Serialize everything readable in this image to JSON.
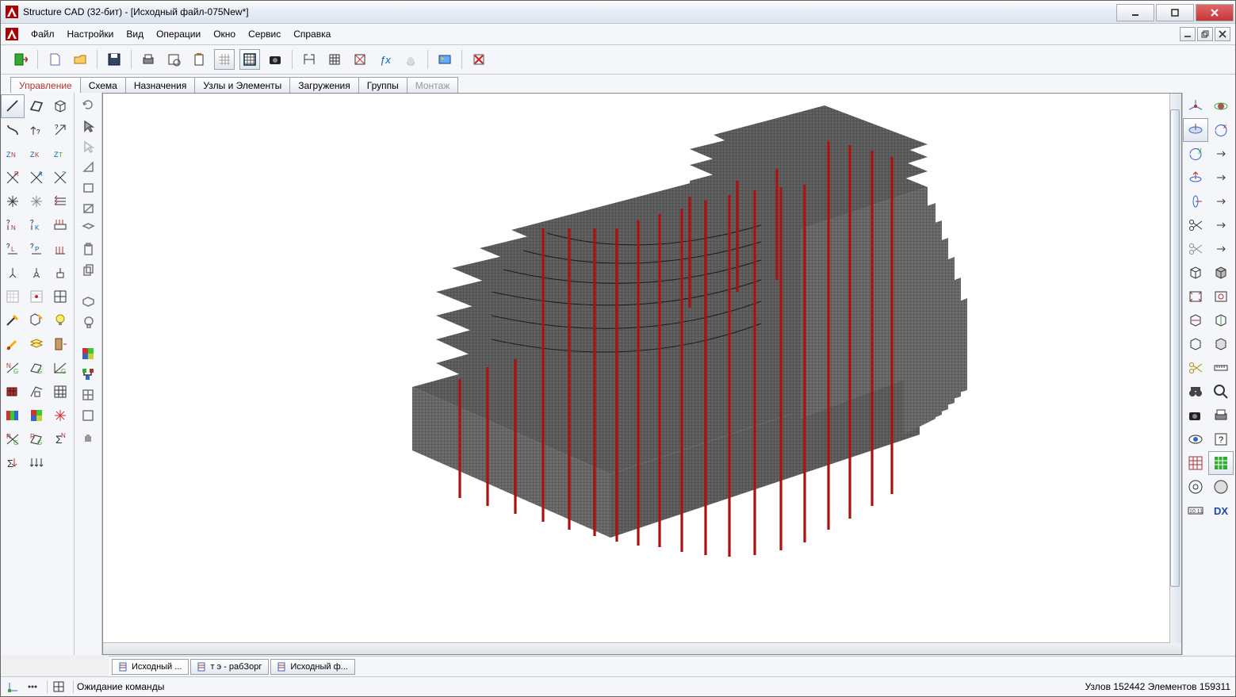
{
  "window": {
    "title": "Structure CAD (32-бит) - [Исходный файл-075New*]"
  },
  "menu": {
    "file": "Файл",
    "settings": "Настройки",
    "view": "Вид",
    "ops": "Операции",
    "window": "Окно",
    "service": "Сервис",
    "help": "Справка"
  },
  "tabs": {
    "t0": "Управление",
    "t1": "Схема",
    "t2": "Назначения",
    "t3": "Узлы и Элементы",
    "t4": "Загружения",
    "t5": "Группы",
    "t6": "Монтаж"
  },
  "doc_tabs": {
    "d0": "Исходный ...",
    "d1": "т э - рабЗорг",
    "d2": "Исходный ф..."
  },
  "status": {
    "message": "Ожидание команды",
    "counts": "Узлов 152442 Элементов 159311"
  },
  "right_panel": {
    "dx_label": "DX"
  }
}
